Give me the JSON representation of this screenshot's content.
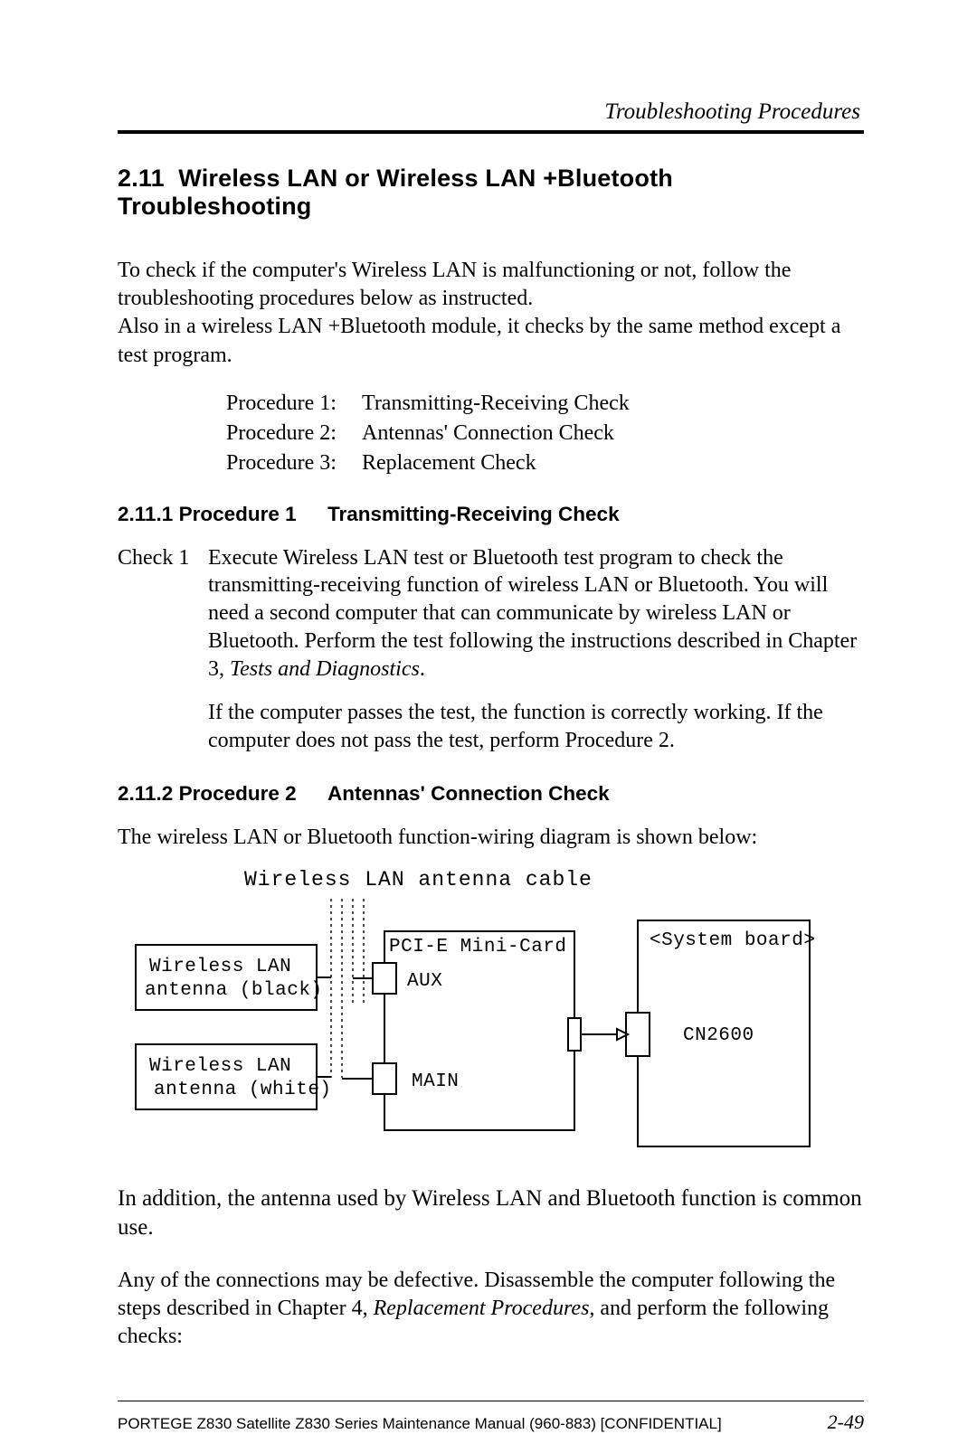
{
  "header": {
    "running": "Troubleshooting Procedures"
  },
  "section": {
    "number": "2.11",
    "title": "Wireless LAN or Wireless LAN +Bluetooth Troubleshooting"
  },
  "intro": {
    "p1": "To check if the computer's Wireless LAN is malfunctioning or not, follow the troubleshooting procedures below as instructed.",
    "p2": "Also in a wireless LAN +Bluetooth module, it checks by the same method except a test program."
  },
  "procedures": [
    {
      "label": "Procedure 1:",
      "text": "Transmitting-Receiving Check"
    },
    {
      "label": "Procedure 2:",
      "text": "Antennas' Connection Check"
    },
    {
      "label": "Procedure 3:",
      "text": "Replacement Check"
    }
  ],
  "proc1": {
    "number": "2.11.1 Procedure 1",
    "title": "Transmitting-Receiving Check",
    "check_label": "Check 1",
    "check_p1a": "Execute Wireless LAN test or Bluetooth test program to check the transmitting-receiving function of wireless LAN or Bluetooth. You will need a second computer that can communicate by wireless LAN or Bluetooth. Perform the test following the instructions described in Chapter 3, ",
    "check_p1_em": "Tests and Diagnostics",
    "check_p1b": ".",
    "check_p2": "If the computer passes the test, the function is correctly working. If the computer does not pass the test, perform Procedure 2."
  },
  "proc2": {
    "number": "2.11.2 Procedure 2",
    "title": "Antennas' Connection Check",
    "lead": "The wireless LAN or Bluetooth function-wiring diagram is shown below:"
  },
  "diagram": {
    "caption": "Wireless LAN antenna cable",
    "box_ant_black_l1": "Wireless LAN",
    "box_ant_black_l2": "antenna (black)",
    "box_ant_white_l1": "Wireless LAN",
    "box_ant_white_l2": "antenna (white)",
    "pci_label": "PCI-E Mini-Card",
    "aux": "AUX",
    "main": "MAIN",
    "sysboard": "<System board>",
    "cn": "CN2600"
  },
  "closing": {
    "p1": "In addition, the antenna used by Wireless LAN and Bluetooth function is common use.",
    "p2a": "Any of the connections may be defective. Disassemble the computer following the steps described in Chapter 4, ",
    "p2_em": "Replacement Procedures",
    "p2b": ", and perform the following checks:"
  },
  "footer": {
    "left": "PORTEGE Z830 Satellite Z830 Series Maintenance Manual (960-883)  [CONFIDENTIAL]",
    "right": "2-49"
  }
}
